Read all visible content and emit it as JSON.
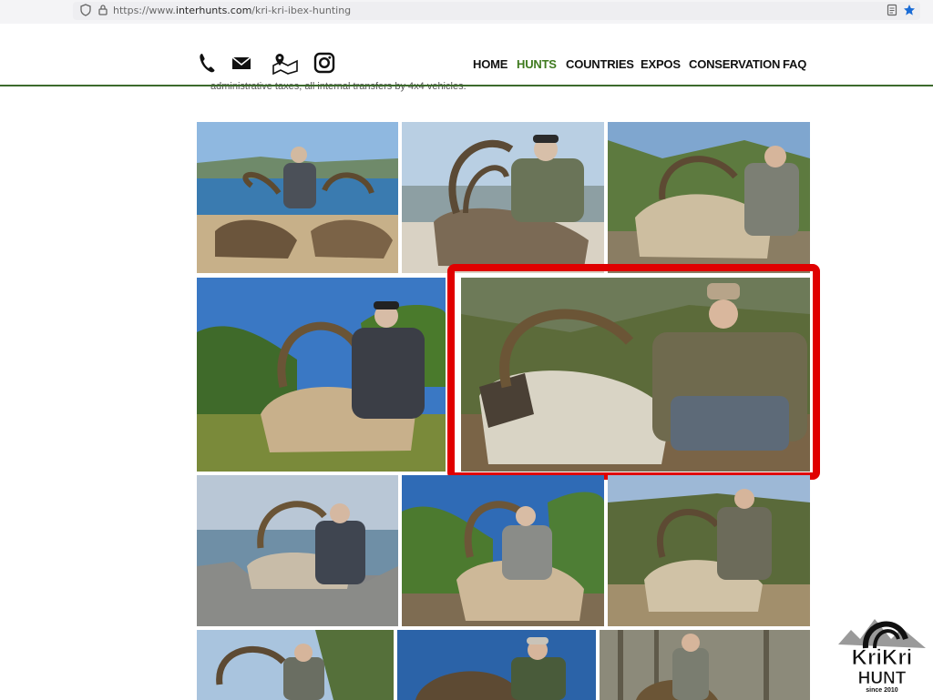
{
  "browser": {
    "url_prefix": "https://www.",
    "url_host": "interhunts.com",
    "url_path": "/kri-kri-ibex-hunting"
  },
  "header": {
    "contact_icons": [
      "phone-icon",
      "mail-icon",
      "map-icon",
      "instagram-icon"
    ],
    "nav": [
      {
        "label": "HOME",
        "active": false
      },
      {
        "label": "HUNTS",
        "active": true
      },
      {
        "label": "COUNTRIES",
        "active": false
      },
      {
        "label": "EXPOS",
        "active": false
      },
      {
        "label": "CONSERVATION",
        "active": false
      },
      {
        "label": "FAQ",
        "active": false
      }
    ]
  },
  "content": {
    "intro_fragment": "administrative taxes, all internal transfers by 4x4 vehicles."
  },
  "colors": {
    "nav_active": "#3f7a1f",
    "header_rule": "#3c6a2c",
    "highlight_border": "#e00000"
  },
  "gallery": {
    "photos": [
      "kri-kri trophy photo",
      "kri-kri trophy photo",
      "kri-kri trophy photo",
      "kri-kri trophy photo",
      "kri-kri trophy photo (highlighted)",
      "kri-kri trophy photo",
      "kri-kri trophy photo",
      "kri-kri trophy photo",
      "kri-kri trophy photo",
      "kri-kri trophy photo",
      "kri-kri trophy photo"
    ]
  },
  "logo": {
    "line1": "KriKri",
    "line2": "HUNT",
    "line3": "since 2010"
  }
}
